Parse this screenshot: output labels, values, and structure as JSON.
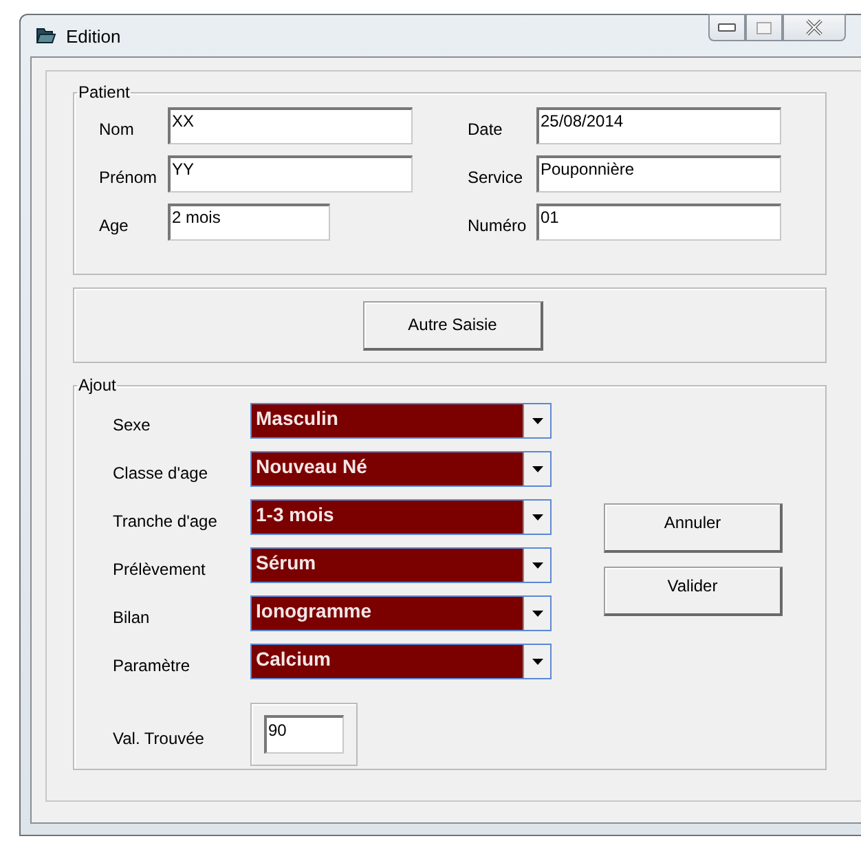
{
  "window": {
    "title": "Edition"
  },
  "patient": {
    "legend": "Patient",
    "left_fields": [
      {
        "label": "Nom",
        "value": "XX"
      },
      {
        "label": "Prénom",
        "value": "YY"
      },
      {
        "label": "Age",
        "value": "2 mois"
      }
    ],
    "right_fields": [
      {
        "label": "Date",
        "value": "25/08/2014"
      },
      {
        "label": "Service",
        "value": "Pouponnière"
      },
      {
        "label": "Numéro",
        "value": "01"
      }
    ]
  },
  "other_entry_button": "Autre Saisie",
  "ajout": {
    "legend": "Ajout",
    "dropdowns": [
      {
        "label": "Sexe",
        "value": "Masculin"
      },
      {
        "label": "Classe d'age",
        "value": "Nouveau Né"
      },
      {
        "label": "Tranche d'age",
        "value": "1-3 mois"
      },
      {
        "label": "Prélèvement",
        "value": "Sérum"
      },
      {
        "label": "Bilan",
        "value": "Ionogramme"
      },
      {
        "label": "Paramètre",
        "value": "Calcium"
      }
    ],
    "found_value": {
      "label": "Val. Trouvée",
      "value": "90"
    },
    "buttons": [
      "Annuler",
      "Valider"
    ]
  }
}
